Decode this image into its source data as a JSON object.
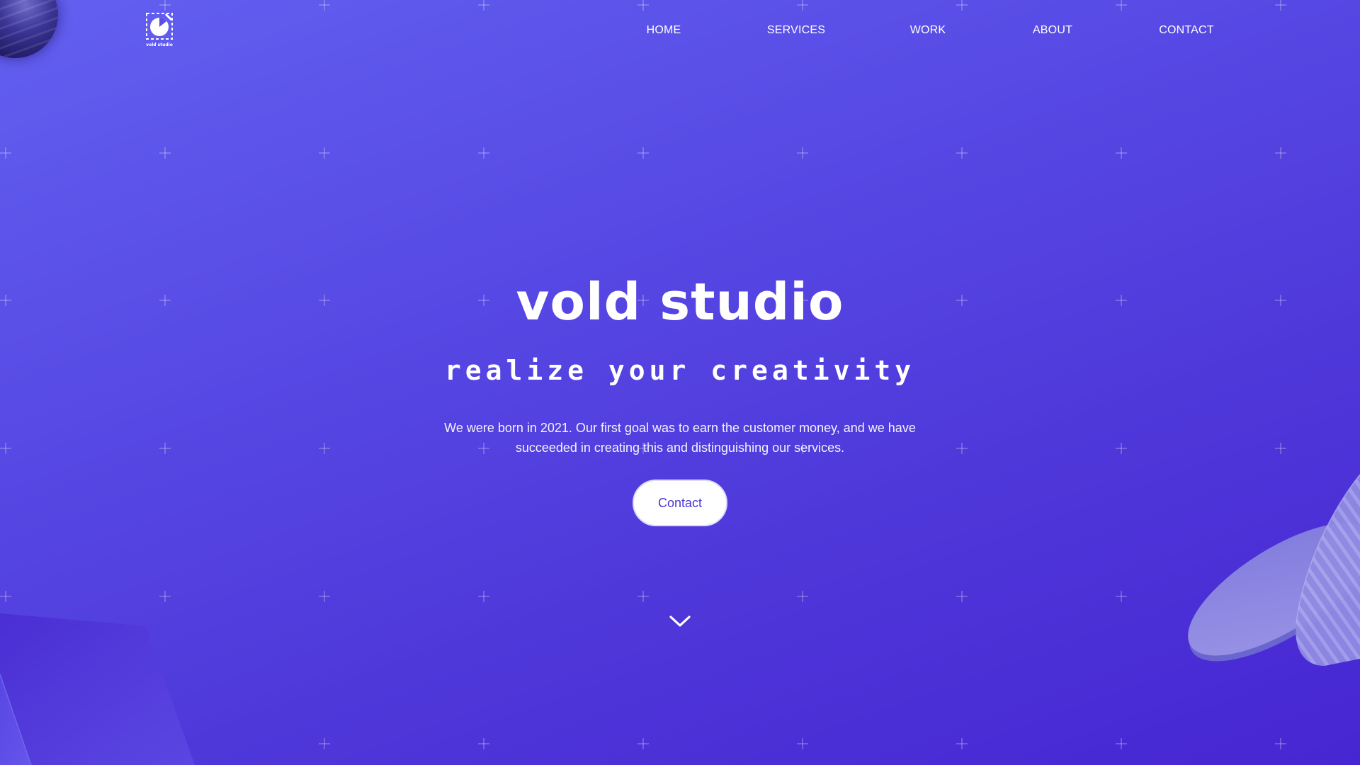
{
  "brand": {
    "name": "vold studio",
    "logo_icon": "vold-studio-logo-icon"
  },
  "nav": {
    "items": [
      {
        "label": "HOME"
      },
      {
        "label": "SERVICES"
      },
      {
        "label": "WORK"
      },
      {
        "label": "ABOUT"
      },
      {
        "label": "CONTACT"
      }
    ]
  },
  "hero": {
    "title": "vold studio",
    "subtitle": "realize your creativity",
    "description": "We were born in 2021. Our first goal was to earn the customer money, and we have succeeded in creating this and distinguishing our services.",
    "cta_label": "Contact",
    "scroll_icon": "chevron-down-icon"
  },
  "colors": {
    "background_start": "#6360f0",
    "background_end": "#4626d2",
    "button_text": "#4a35d6",
    "button_bg": "#ffffff"
  }
}
